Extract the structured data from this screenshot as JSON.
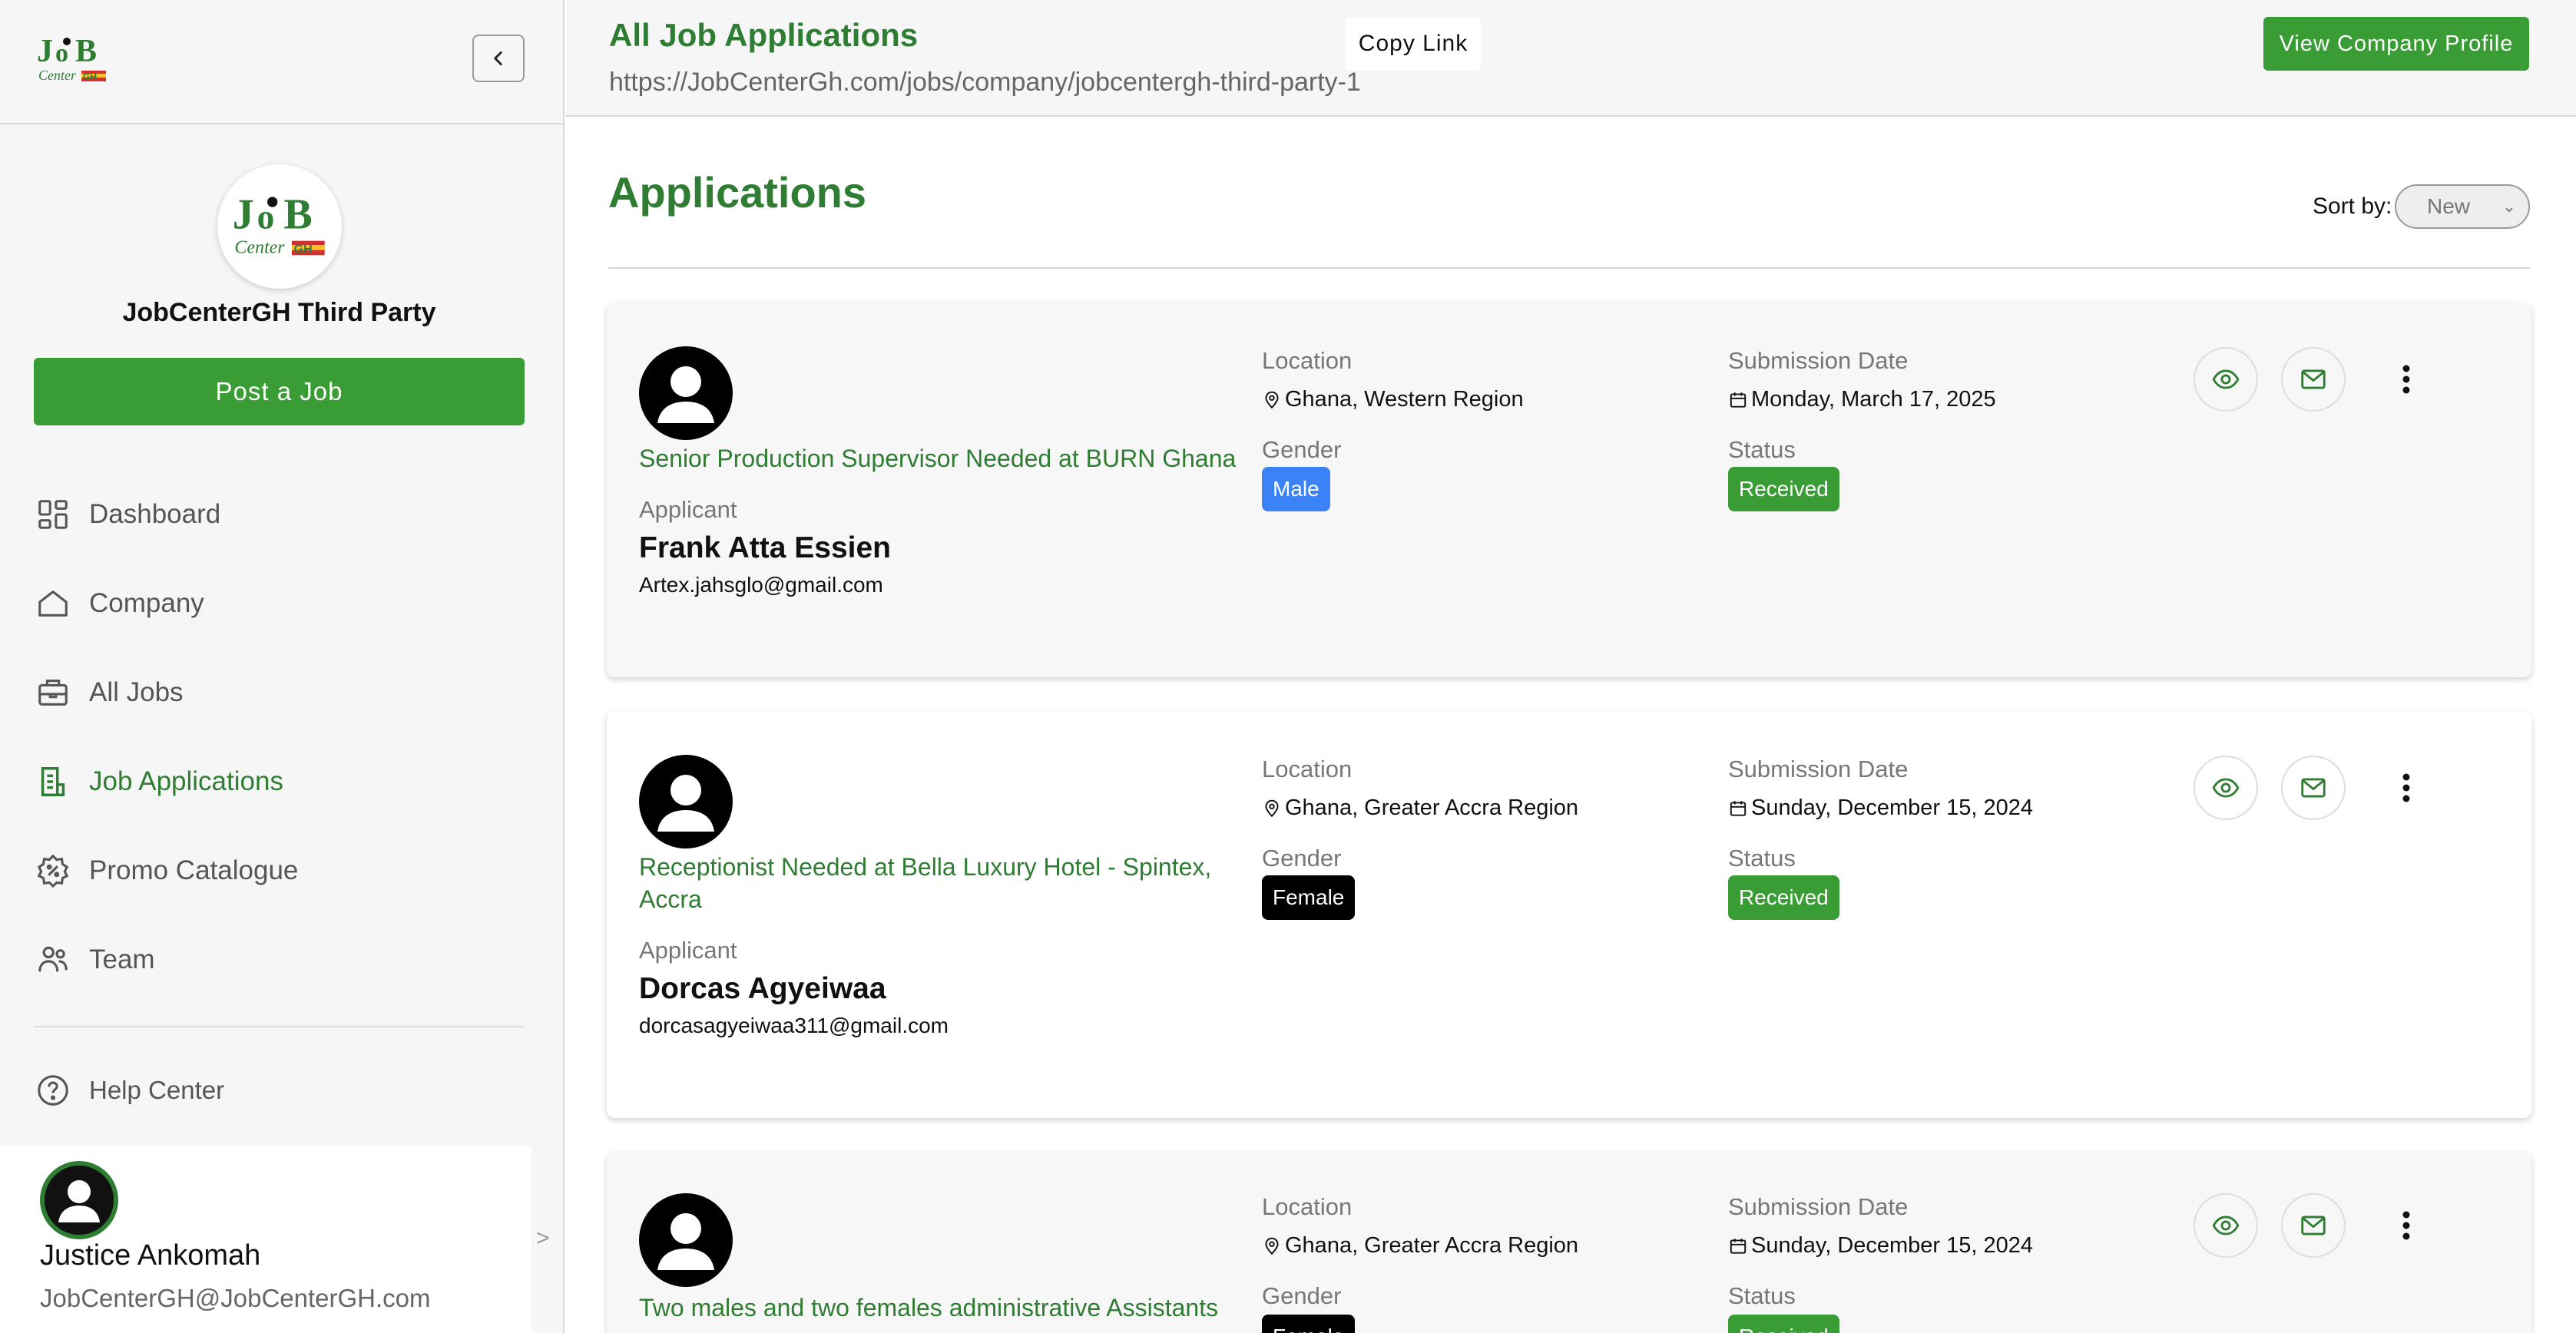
{
  "sidebar": {
    "logo_alt": "JobCenterGH",
    "company_name": "JobCenterGH Third Party",
    "post_job_label": "Post a Job",
    "nav": [
      {
        "label": "Dashboard",
        "icon": "dashboard-icon"
      },
      {
        "label": "Company",
        "icon": "home-icon"
      },
      {
        "label": "All Jobs",
        "icon": "briefcase-icon"
      },
      {
        "label": "Job Applications",
        "icon": "document-icon",
        "active": true
      },
      {
        "label": "Promo Catalogue",
        "icon": "discount-badge-icon"
      },
      {
        "label": "Team",
        "icon": "team-icon"
      }
    ],
    "help_label": "Help Center",
    "user": {
      "name": "Justice Ankomah",
      "email": "JobCenterGH@JobCenterGH.com"
    },
    "expand_glyph": ">"
  },
  "topbar": {
    "title": "All Job Applications",
    "url": "https://JobCenterGh.com/jobs/company/jobcentergh-third-party-1",
    "copy_link_label": "Copy Link",
    "view_profile_label": "View Company Profile"
  },
  "main": {
    "title": "Applications",
    "sort_label": "Sort by:",
    "sort_value": "New",
    "labels": {
      "applicant": "Applicant",
      "location": "Location",
      "gender": "Gender",
      "submission_date": "Submission Date",
      "status": "Status"
    },
    "applications": [
      {
        "job_title": "Senior Production Supervisor Needed at BURN Ghana",
        "applicant_name": "Frank Atta Essien",
        "applicant_email": "Artex.jahsglo@gmail.com",
        "location": "Ghana, Western Region",
        "gender": "Male",
        "submission_date": "Monday, March 17, 2025",
        "status": "Received"
      },
      {
        "job_title": "Receptionist Needed at Bella Luxury Hotel - Spintex, Accra",
        "applicant_name": "Dorcas Agyeiwaa",
        "applicant_email": "dorcasagyeiwaa311@gmail.com",
        "location": "Ghana, Greater Accra Region",
        "gender": "Female",
        "submission_date": "Sunday, December 15, 2024",
        "status": "Received"
      },
      {
        "job_title": "Two males and two females administrative Assistants",
        "location": "Ghana, Greater Accra Region",
        "gender": "Female",
        "submission_date": "Sunday, December 15, 2024",
        "status": "Received"
      }
    ]
  },
  "colors": {
    "brand_green": "#2e7d32",
    "button_green": "#3a9c35",
    "male_badge": "#3b82f6",
    "female_badge": "#000000",
    "received_badge": "#3a9c35"
  }
}
